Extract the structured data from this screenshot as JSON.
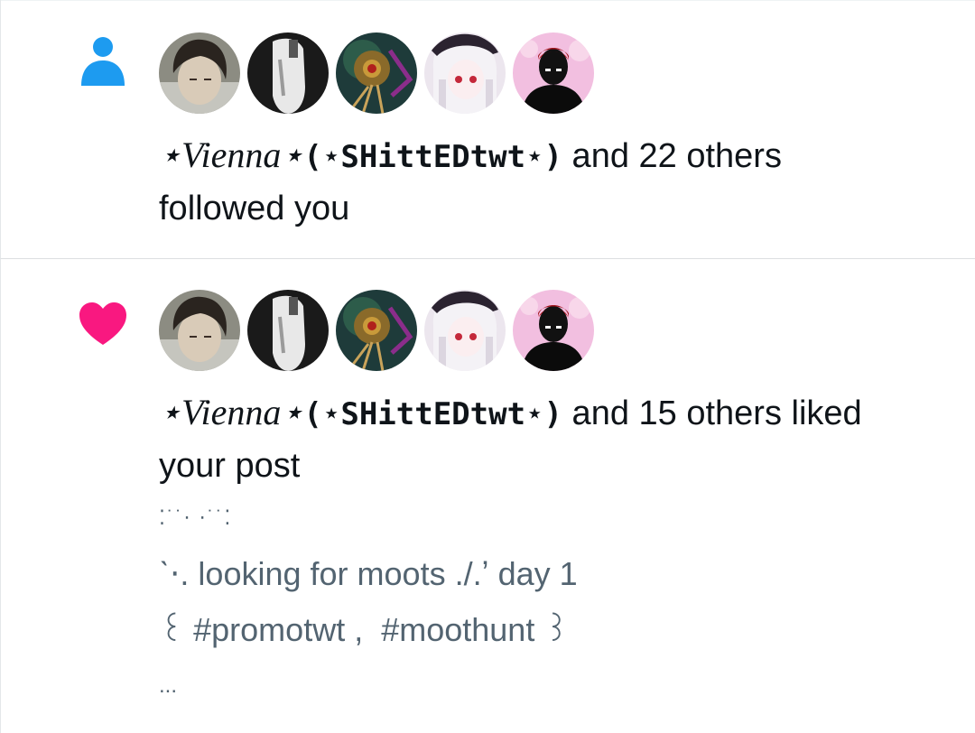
{
  "notifications": [
    {
      "type": "follow",
      "icon": "person-icon",
      "icon_color": "#1d9bf0",
      "actor_prefix": "⋆Vienna⋆",
      "actor_handle": "(⋆SHittEDtwt⋆)",
      "summary_rest": " and 22 others",
      "summary_line2": "followed you",
      "avatars": [
        "avatar-dark-hair-boy",
        "avatar-white-ghost",
        "avatar-ornament-flower",
        "avatar-white-hair-girl",
        "avatar-red-hair-silhouette"
      ]
    },
    {
      "type": "like",
      "icon": "heart-icon",
      "icon_color": "#f91880",
      "actor_prefix": "⋆Vienna⋆",
      "actor_handle": "(⋆SHittEDtwt⋆)",
      "summary_rest": " and 15 others liked",
      "summary_line2": "your post",
      "avatars": [
        "avatar-dark-hair-boy",
        "avatar-white-ghost",
        "avatar-ornament-flower",
        "avatar-white-hair-girl",
        "avatar-red-hair-silhouette"
      ],
      "post_preview": [
        "⁚˙˙⋅ ⋅˙˙⁚",
        "ˋ⋅. looking for moots ./.ʼ day 1",
        "꒰ #promotwt ,  #moothunt ꒱",
        "..."
      ]
    }
  ]
}
